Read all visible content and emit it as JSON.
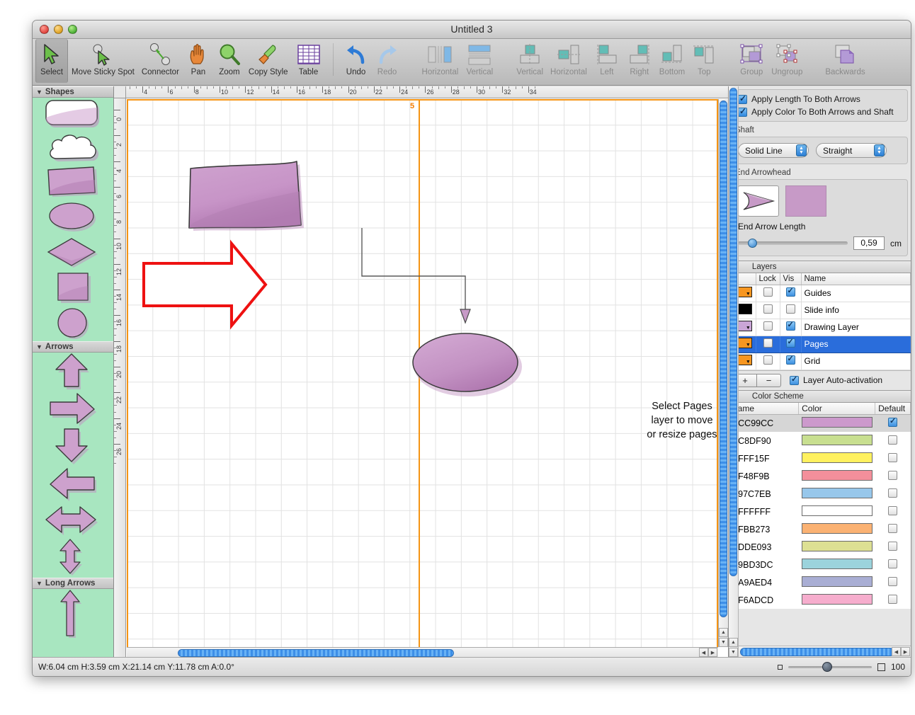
{
  "window": {
    "title": "Untitled 3"
  },
  "toolbar": {
    "items": [
      {
        "label": "Select",
        "icon": "arrow-cursor-icon",
        "selected": true,
        "dim": false
      },
      {
        "label": "Move Sticky Spot",
        "icon": "move-sticky-spot-icon",
        "selected": false,
        "dim": false
      },
      {
        "label": "Connector",
        "icon": "connector-icon",
        "selected": false,
        "dim": false
      },
      {
        "label": "Pan",
        "icon": "hand-icon",
        "selected": false,
        "dim": false
      },
      {
        "label": "Zoom",
        "icon": "magnifier-icon",
        "selected": false,
        "dim": false
      },
      {
        "label": "Copy Style",
        "icon": "paintbrush-icon",
        "selected": false,
        "dim": false
      },
      {
        "label": "Table",
        "icon": "table-grid-icon",
        "selected": false,
        "dim": false
      },
      {
        "label": "Undo",
        "icon": "undo-arrow-icon",
        "selected": false,
        "dim": false
      },
      {
        "label": "Redo",
        "icon": "redo-arrow-icon",
        "selected": false,
        "dim": true
      },
      {
        "label": "Horizontal",
        "icon": "distribute-horizontal-icon",
        "selected": false,
        "dim": true
      },
      {
        "label": "Vertical",
        "icon": "distribute-vertical-icon",
        "selected": false,
        "dim": true
      },
      {
        "label": "Vertical",
        "icon": "align-center-vertical-icon",
        "selected": false,
        "dim": true
      },
      {
        "label": "Horizontal",
        "icon": "align-center-horizontal-icon",
        "selected": false,
        "dim": true
      },
      {
        "label": "Left",
        "icon": "align-left-icon",
        "selected": false,
        "dim": true
      },
      {
        "label": "Right",
        "icon": "align-right-icon",
        "selected": false,
        "dim": true
      },
      {
        "label": "Bottom",
        "icon": "align-bottom-icon",
        "selected": false,
        "dim": true
      },
      {
        "label": "Top",
        "icon": "align-top-icon",
        "selected": false,
        "dim": true
      },
      {
        "label": "Group",
        "icon": "group-icon",
        "selected": false,
        "dim": true
      },
      {
        "label": "Ungroup",
        "icon": "ungroup-icon",
        "selected": false,
        "dim": true
      },
      {
        "label": "Backwards",
        "icon": "send-backwards-icon",
        "selected": false,
        "dim": true
      }
    ]
  },
  "palette": {
    "sections": [
      {
        "title": "Shapes",
        "shapes": [
          "rounded-rectangle-white-shape",
          "cloud-shape",
          "rectangle-shape",
          "ellipse-shape",
          "diamond-shape",
          "square-shape",
          "circle-shape"
        ]
      },
      {
        "title": "Arrows",
        "shapes": [
          "arrow-up-shape",
          "arrow-right-shape",
          "arrow-down-shape",
          "arrow-left-shape",
          "arrow-left-right-shape",
          "arrow-up-down-shape"
        ]
      },
      {
        "title": "Long Arrows",
        "shapes": [
          "long-arrow-up-shape"
        ]
      }
    ]
  },
  "canvas": {
    "ruler_units": "cm",
    "h_ticks": [
      4,
      6,
      8,
      10,
      12,
      14,
      16,
      18,
      20,
      22,
      24,
      26,
      28,
      30,
      32
    ],
    "v_ticks": [
      0,
      2,
      4,
      6,
      8,
      10,
      12,
      14,
      16,
      18,
      20,
      22,
      24,
      26
    ],
    "page_number": "5",
    "annotation": {
      "line1": "Select Pages",
      "line2": "layer to move",
      "line3": "or resize pages",
      "arrow_color": "#ee1111"
    },
    "objects": [
      {
        "name": "rectangle-shape",
        "fill": "#c48fc4"
      },
      {
        "name": "ellipse-shape",
        "fill": "#c48fc4"
      },
      {
        "name": "connector-line",
        "stroke": "#555555"
      }
    ]
  },
  "inspector": {
    "arrows": {
      "apply_length_label": "Apply Length To Both Arrows",
      "apply_length_checked": true,
      "apply_color_label": "Apply Color To Both Arrows and Shaft",
      "apply_color_checked": true
    },
    "shaft": {
      "section_label": "Shaft",
      "style_value": "Solid Line",
      "style_options": [
        "Solid Line"
      ],
      "shape_value": "Straight",
      "shape_options": [
        "Straight"
      ]
    },
    "end_arrowhead": {
      "section_label": "End Arrowhead",
      "color": "#c79ac7",
      "length_label": "End Arrow Length",
      "length_value": "0,59",
      "length_unit": "cm"
    },
    "layers": {
      "title": "Layers",
      "columns": [
        "",
        "Lock",
        "Vis",
        "Name"
      ],
      "rows": [
        {
          "swatch": "#f79620",
          "has_chevron": true,
          "lock": false,
          "vis": true,
          "name": "Guides",
          "selected": false
        },
        {
          "swatch": "#000000",
          "has_chevron": false,
          "lock": false,
          "vis": false,
          "name": "Slide info",
          "selected": false
        },
        {
          "swatch": "#c9a5d6",
          "has_chevron": true,
          "lock": false,
          "vis": true,
          "name": "Drawing Layer",
          "selected": false
        },
        {
          "swatch": "#f79620",
          "has_chevron": true,
          "lock": false,
          "vis": true,
          "name": "Pages",
          "selected": true
        },
        {
          "swatch": "#f79620",
          "has_chevron": true,
          "lock": false,
          "vis": true,
          "name": "Grid",
          "selected": false
        }
      ],
      "add_label": "+",
      "remove_label": "−",
      "auto_activation_label": "Layer Auto-activation",
      "auto_activation_checked": true
    },
    "color_scheme": {
      "title": "Color Scheme",
      "columns": [
        "Name",
        "Color",
        "Default"
      ],
      "rows": [
        {
          "name": "CC99CC",
          "color": "#cc99cc",
          "default": true
        },
        {
          "name": "C8DF90",
          "color": "#c8df90",
          "default": false
        },
        {
          "name": "FFF15F",
          "color": "#fff15f",
          "default": false
        },
        {
          "name": "F48F9B",
          "color": "#f48f9b",
          "default": false
        },
        {
          "name": "97C7EB",
          "color": "#97c7eb",
          "default": false
        },
        {
          "name": "FFFFFF",
          "color": "#ffffff",
          "default": false
        },
        {
          "name": "FBB273",
          "color": "#fbb273",
          "default": false
        },
        {
          "name": "DDE093",
          "color": "#dde093",
          "default": false
        },
        {
          "name": "9BD3DC",
          "color": "#9bd3dc",
          "default": false
        },
        {
          "name": "A9AED4",
          "color": "#a9aed4",
          "default": false
        },
        {
          "name": "F6ADCD",
          "color": "#f6adcd",
          "default": false
        }
      ]
    }
  },
  "statusbar": {
    "info": "W:6.04 cm H:3.59 cm X:21.14 cm Y:11.78 cm A:0.0°",
    "zoom_value": "100"
  }
}
